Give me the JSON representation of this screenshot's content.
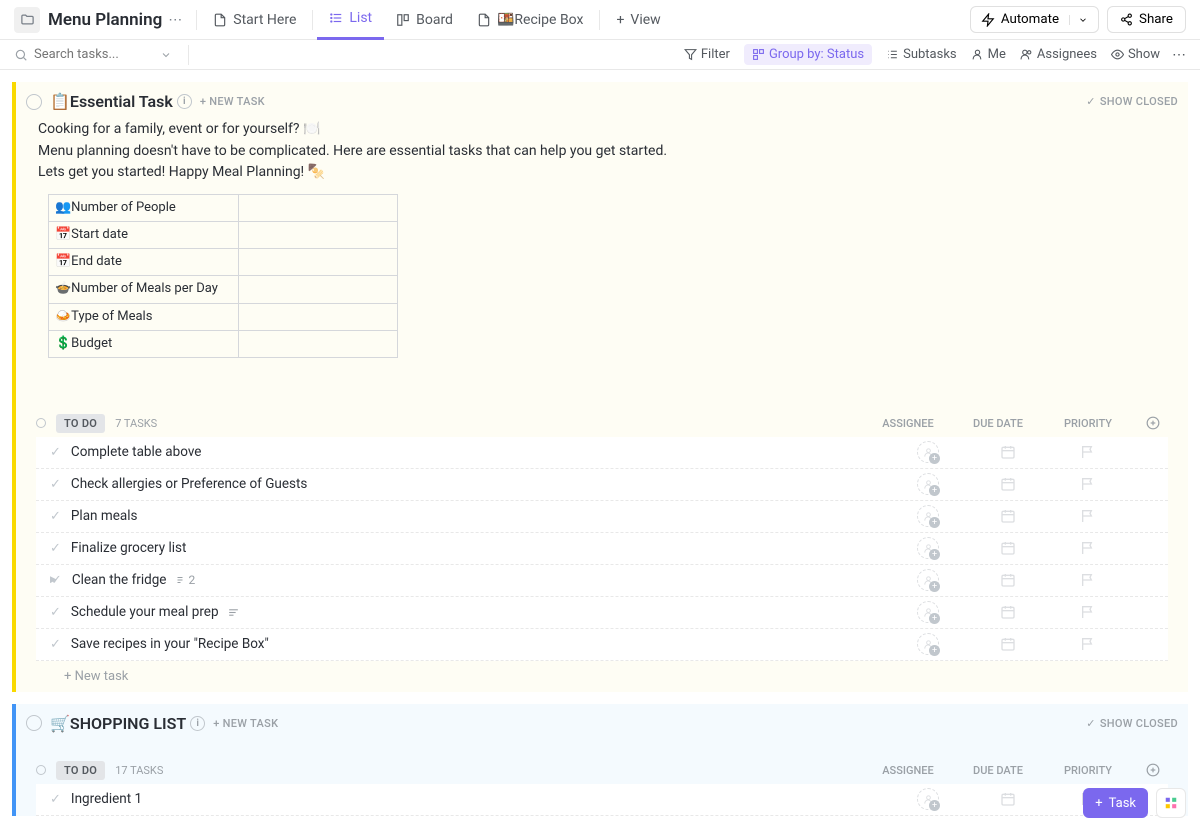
{
  "header": {
    "title": "Menu Planning",
    "tabs": {
      "start": "Start Here",
      "list": "List",
      "board": "Board",
      "recipe": "🍱Recipe Box",
      "view": "View"
    },
    "automate": "Automate",
    "share": "Share"
  },
  "toolbar": {
    "search_placeholder": "Search tasks...",
    "filter": "Filter",
    "groupby": "Group by: Status",
    "subtasks": "Subtasks",
    "me": "Me",
    "assignees": "Assignees",
    "show": "Show"
  },
  "sections": {
    "essential": {
      "title": "📋Essential Task",
      "new_task": "+ NEW TASK",
      "show_closed": "SHOW CLOSED",
      "desc_line1": "Cooking for a family, event or for yourself? 🍽️",
      "desc_line2": "Menu planning doesn't have to be complicated. Here are essential tasks that can help you get started.",
      "desc_line3": "Lets get you started! Happy Meal Planning! 🍢",
      "plan_rows": [
        "👥Number of People",
        "📅Start date",
        "📅End date",
        "🍲Number of Meals per Day",
        "🍛Type of Meals",
        "💲Budget"
      ],
      "status_label": "TO DO",
      "task_count": "7 TASKS",
      "cols": {
        "assignee": "ASSIGNEE",
        "duedate": "DUE DATE",
        "priority": "PRIORITY"
      },
      "tasks": [
        {
          "name": "Complete table above"
        },
        {
          "name": "Check allergies or Preference of Guests"
        },
        {
          "name": "Plan meals"
        },
        {
          "name": "Finalize grocery list"
        },
        {
          "name": "Clean the fridge",
          "sub": "2",
          "caret": true
        },
        {
          "name": "Schedule your meal prep",
          "bars": true
        },
        {
          "name": "Save recipes in your \"Recipe Box\""
        }
      ],
      "new_task_row": "+ New task"
    },
    "shopping": {
      "title": "🛒SHOPPING LIST",
      "new_task": "+ NEW TASK",
      "show_closed": "SHOW CLOSED",
      "status_label": "TO DO",
      "task_count": "17 TASKS",
      "cols": {
        "assignee": "ASSIGNEE",
        "duedate": "DUE DATE",
        "priority": "PRIORITY"
      },
      "tasks": [
        {
          "name": "Ingredient 1"
        }
      ]
    }
  },
  "fab": {
    "task": "Task"
  }
}
